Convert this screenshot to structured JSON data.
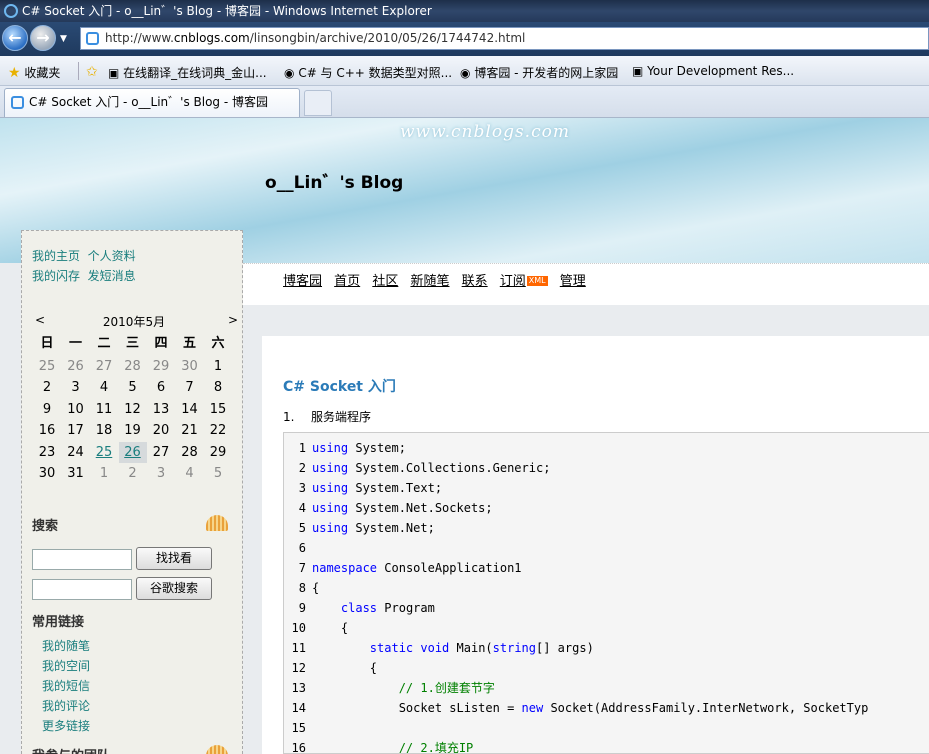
{
  "window": {
    "title": "C# Socket 入门 - o__Lin゛'s Blog - 博客园 - Windows Internet Explorer"
  },
  "address": {
    "url_prefix": "http://www.",
    "url_domain": "cnblogs.com",
    "url_path": "/linsongbin/archive/2010/05/26/1744742.html"
  },
  "favorites": {
    "label": "收藏夹",
    "items": [
      "在线翻译_在线词典_金山...",
      "C# 与 C++ 数据类型对照...",
      "博客园 - 开发者的网上家园",
      "Your Development Res..."
    ]
  },
  "tab": {
    "label": "C# Socket 入门 - o__Lin゛'s Blog - 博客园"
  },
  "header": {
    "watermark": "www.cnblogs.com",
    "blog_title": "o__Lin゛'s Blog"
  },
  "nav": {
    "items": [
      "博客园",
      "首页",
      "社区",
      "新随笔",
      "联系",
      "订阅",
      "管理"
    ],
    "xml_badge": "XML"
  },
  "sidebar": {
    "links": [
      "我的主页",
      "个人资料",
      "我的闪存",
      "发短消息"
    ],
    "calendar": {
      "prev": "<",
      "next": ">",
      "month": "2010年5月",
      "weekdays": [
        "日",
        "一",
        "二",
        "三",
        "四",
        "五",
        "六"
      ],
      "weeks": [
        [
          "25",
          "26",
          "27",
          "28",
          "29",
          "30",
          "1"
        ],
        [
          "2",
          "3",
          "4",
          "5",
          "6",
          "7",
          "8"
        ],
        [
          "9",
          "10",
          "11",
          "12",
          "13",
          "14",
          "15"
        ],
        [
          "16",
          "17",
          "18",
          "19",
          "20",
          "21",
          "22"
        ],
        [
          "23",
          "24",
          "25",
          "26",
          "27",
          "28",
          "29"
        ],
        [
          "30",
          "31",
          "1",
          "2",
          "3",
          "4",
          "5"
        ]
      ],
      "linked_days": [
        "25",
        "26"
      ],
      "selected_day": "26"
    },
    "search": {
      "title": "搜索",
      "button1": "找找看",
      "button2": "谷歌搜索"
    },
    "common_links": {
      "title": "常用链接",
      "items": [
        "我的随笔",
        "我的空间",
        "我的短信",
        "我的评论",
        "更多链接"
      ]
    },
    "next_section": "我参与的团队"
  },
  "post": {
    "title": "C# Socket 入门",
    "list_num": "1.",
    "list_text": "服务端程序",
    "code_lines": [
      [
        [
          "kw",
          "using"
        ],
        [
          "",
          "System;"
        ]
      ],
      [
        [
          "kw",
          "using"
        ],
        [
          "",
          "System.Collections.Generic;"
        ]
      ],
      [
        [
          "kw",
          "using"
        ],
        [
          "",
          "System.Text;"
        ]
      ],
      [
        [
          "kw",
          "using"
        ],
        [
          "",
          "System.Net.Sockets;"
        ]
      ],
      [
        [
          "kw",
          "using"
        ],
        [
          "",
          "System.Net;"
        ]
      ],
      [],
      [
        [
          "kw",
          "namespace"
        ],
        [
          "",
          "ConsoleApplication1"
        ]
      ],
      [
        [
          "",
          "{"
        ]
      ],
      [
        [
          "",
          "    "
        ],
        [
          "kw",
          "class"
        ],
        [
          "",
          "Program"
        ]
      ],
      [
        [
          "",
          "    {"
        ]
      ],
      [
        [
          "",
          "        "
        ],
        [
          "kw",
          "static void"
        ],
        [
          "",
          "Main("
        ],
        [
          "kw",
          "string"
        ],
        [
          "",
          "[] args)"
        ]
      ],
      [
        [
          "",
          "        {"
        ]
      ],
      [
        [
          "",
          "            "
        ],
        [
          "cm",
          "// 1.创建套节字"
        ]
      ],
      [
        [
          "",
          "            Socket sListen = "
        ],
        [
          "kw",
          "new"
        ],
        [
          "",
          "Socket(AddressFamily.InterNetwork, SocketTyp"
        ]
      ],
      [],
      [
        [
          "",
          "            "
        ],
        [
          "cm",
          "// 2.填充IP"
        ]
      ]
    ]
  }
}
